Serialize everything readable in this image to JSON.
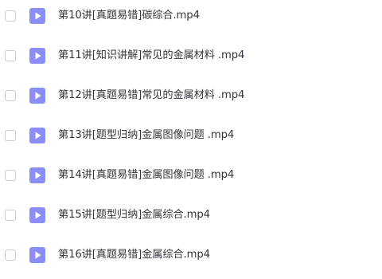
{
  "icon_color": "#8a8ef5",
  "files": [
    {
      "name": "第10讲[真题易错]碳综合.mp4",
      "icon": "video-file-icon"
    },
    {
      "name": "第11讲[知识讲解]常见的金属材料 .mp4",
      "icon": "video-file-icon"
    },
    {
      "name": "第12讲[真题易错]常见的金属材料 .mp4",
      "icon": "video-file-icon"
    },
    {
      "name": "第13讲[题型归纳]金属图像问题 .mp4",
      "icon": "video-file-icon"
    },
    {
      "name": "第14讲[真题易错]金属图像问题 .mp4",
      "icon": "video-file-icon"
    },
    {
      "name": "第15讲[题型归纳]金属综合.mp4",
      "icon": "video-file-icon"
    },
    {
      "name": "第16讲[真题易错]金属综合.mp4",
      "icon": "video-file-icon"
    }
  ]
}
